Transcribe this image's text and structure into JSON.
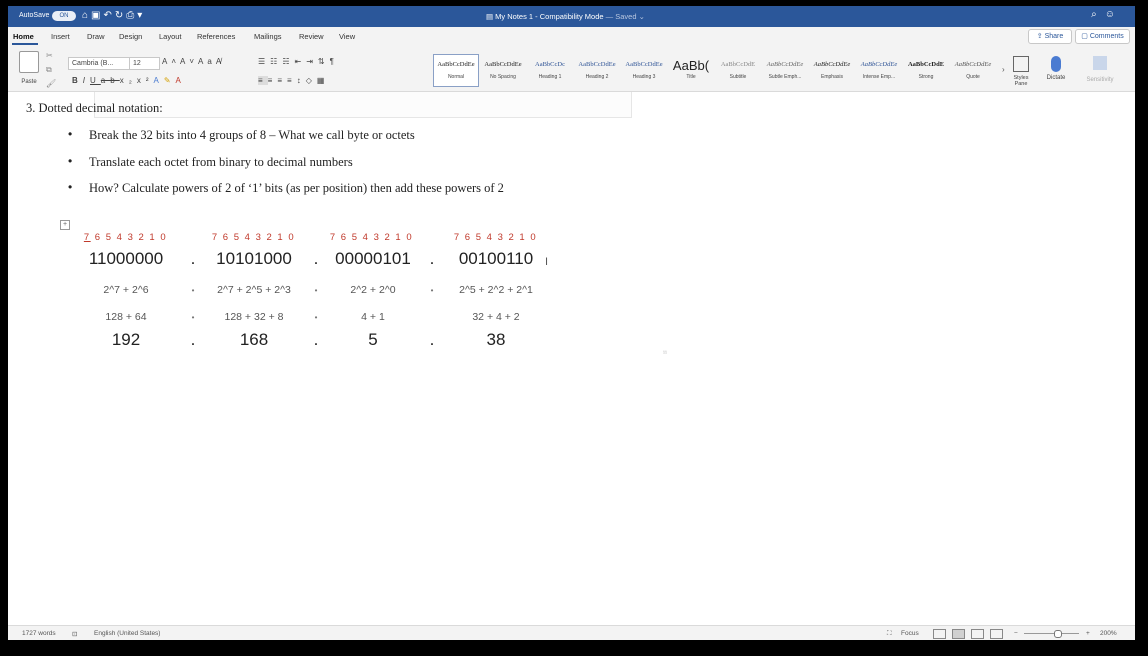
{
  "titlebar": {
    "autosave_label": "AutoSave",
    "autosave_state": "ON",
    "document_title": "My Notes 1 - Compatibility Mode",
    "saved_status": "— Saved ⌄",
    "search_icon": "search-icon",
    "account_icon": "smiley-icon"
  },
  "menu": {
    "tabs": [
      "Home",
      "Insert",
      "Draw",
      "Design",
      "Layout",
      "References",
      "Mailings",
      "Review",
      "View"
    ],
    "active_tab": "Home",
    "share_label": "Share",
    "comments_label": "Comments"
  },
  "ribbon": {
    "paste_label": "Paste",
    "font_name": "Cambria (B...",
    "font_size": "12",
    "styles": [
      {
        "sample": "AaBbCcDdEe",
        "name": "Normal"
      },
      {
        "sample": "AaBbCcDdEe",
        "name": "No Spacing"
      },
      {
        "sample": "AaBbCcDc",
        "name": "Heading 1"
      },
      {
        "sample": "AaBbCcDdEe",
        "name": "Heading 2"
      },
      {
        "sample": "AaBbCcDdEe",
        "name": "Heading 3"
      },
      {
        "sample": "AaBb(",
        "name": "Title"
      },
      {
        "sample": "AaBbCcDdE",
        "name": "Subtitle"
      },
      {
        "sample": "AaBbCcDdEe",
        "name": "Subtle Emph..."
      },
      {
        "sample": "AaBbCcDdEe",
        "name": "Emphasis"
      },
      {
        "sample": "AaBbCcDdEe",
        "name": "Intense Emp..."
      },
      {
        "sample": "AaBbCcDdE",
        "name": "Strong"
      },
      {
        "sample": "AaBbCcDdEe",
        "name": "Quote"
      }
    ],
    "styles_pane_label": "Styles Pane",
    "dictate_label": "Dictate",
    "sensitivity_label": "Sensitivity"
  },
  "document": {
    "heading": "3.  Dotted decimal notation:",
    "bullets": [
      "Break the 32 bits into 4 groups of 8 – What we call byte or octets",
      "Translate each octet from binary to decimal numbers",
      "How? Calculate powers of 2 of ‘1’ bits (as per position) then add these powers of 2"
    ],
    "octets": [
      {
        "positions_first": "7",
        "positions_rest": "6 5 4 3 2 1 0",
        "binary": "11000000",
        "powers": "2^7 + 2^6",
        "sum": "128 + 64",
        "decimal": "192"
      },
      {
        "positions_first": "",
        "positions_rest": "7 6 5 4 3 2 1 0",
        "binary": "10101000",
        "powers": "2^7 + 2^5 + 2^3",
        "sum": "128 + 32 + 8",
        "decimal": "168"
      },
      {
        "positions_first": "",
        "positions_rest": "7 6 5 4 3 2 1 0",
        "binary": "00000101",
        "powers": "2^2 + 2^0",
        "sum": "4 + 1",
        "decimal": "5"
      },
      {
        "positions_first": "",
        "positions_rest": "7 6 5 4 3 2 1 0",
        "binary": "00100110",
        "powers": "2^5 + 2^2 + 2^1",
        "sum": "32 + 4 + 2",
        "decimal": "38"
      }
    ],
    "separator_big": ".",
    "separator_small": "•"
  },
  "statusbar": {
    "word_count": "1727 words",
    "language": "English (United States)",
    "focus_label": "Focus",
    "zoom": "200%"
  }
}
